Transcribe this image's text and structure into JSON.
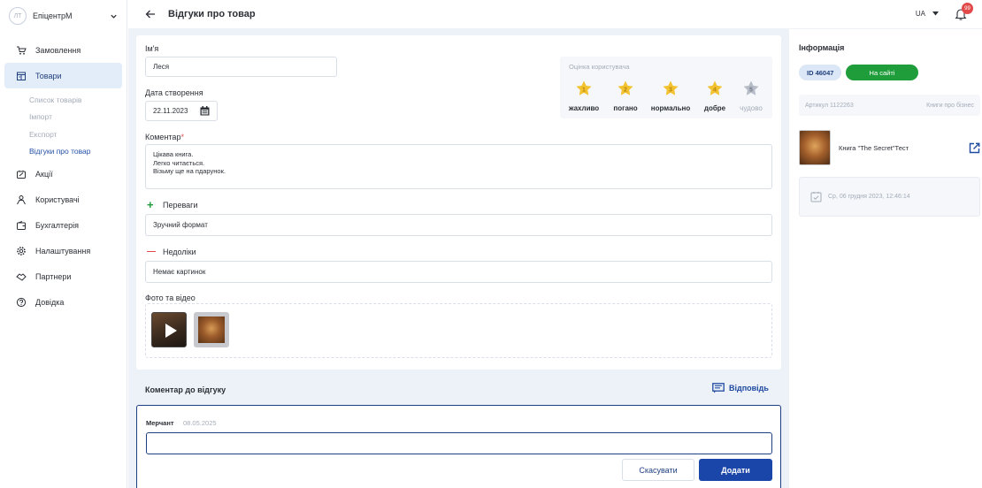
{
  "sidebar": {
    "avatar_initials": "ЛТ",
    "brand": "ЕпіцентрМ",
    "items": [
      {
        "label": "Замовлення",
        "icon": "cart-icon"
      },
      {
        "label": "Товари",
        "icon": "store-icon"
      },
      {
        "label": "Акції",
        "icon": "promo-icon"
      },
      {
        "label": "Користувачі",
        "icon": "users-icon"
      },
      {
        "label": "Бухгалтерія",
        "icon": "wallet-icon"
      },
      {
        "label": "Налаштування",
        "icon": "gear-icon"
      },
      {
        "label": "Партнери",
        "icon": "handshake-icon"
      },
      {
        "label": "Довідка",
        "icon": "help-icon"
      }
    ],
    "subitems": [
      {
        "label": "Список товарів"
      },
      {
        "label": "Імпорт"
      },
      {
        "label": "Експорт"
      },
      {
        "label": "Відгуки про товар"
      }
    ]
  },
  "header": {
    "title": "Відгуки про товар",
    "lang": "UA",
    "notifications": "99"
  },
  "form": {
    "name_label": "Ім'я",
    "name_value": "Леся",
    "date_label": "Дата створення",
    "date_value": "22.11.2023",
    "comment_label": "Коментар",
    "comment_required": "*",
    "comment_lines": [
      "Цікава книга.",
      "Легко читається.",
      "Візьму ще на пдарунок."
    ],
    "pros_label": "Переваги",
    "pros_sign": "+",
    "pros_value": "Зручний формат",
    "cons_label": "Недоліки",
    "cons_sign": "—",
    "cons_value": "Немає картинок",
    "media_label": "Фото та відео"
  },
  "rating": {
    "title": "Оцінка користувача",
    "value": 4,
    "labels": [
      "жахливо",
      "погано",
      "нормально",
      "добре",
      "чудово"
    ],
    "star_color": "#f2c230",
    "star_empty_color": "#b7bdc8"
  },
  "review_comment": {
    "heading": "Коментар до відгуку",
    "reply_label": "Відповідь",
    "author": "Мерчант",
    "date": "08.05.2025",
    "input_value": "",
    "cancel_label": "Скасувати",
    "submit_label": "Додати"
  },
  "info": {
    "title": "Інформація",
    "id": "ID 46047",
    "status": "На сайті",
    "sku": "Артикул 1122263",
    "category": "Книги про бізнес",
    "product_name": "Книга \"The Secret\"Тест",
    "date": "Ср, 06 грудня 2023, 12:46:14"
  },
  "colors": {
    "primary": "#1946a8",
    "status_green": "#1f9d3a",
    "badge_red": "#e24a4a"
  }
}
